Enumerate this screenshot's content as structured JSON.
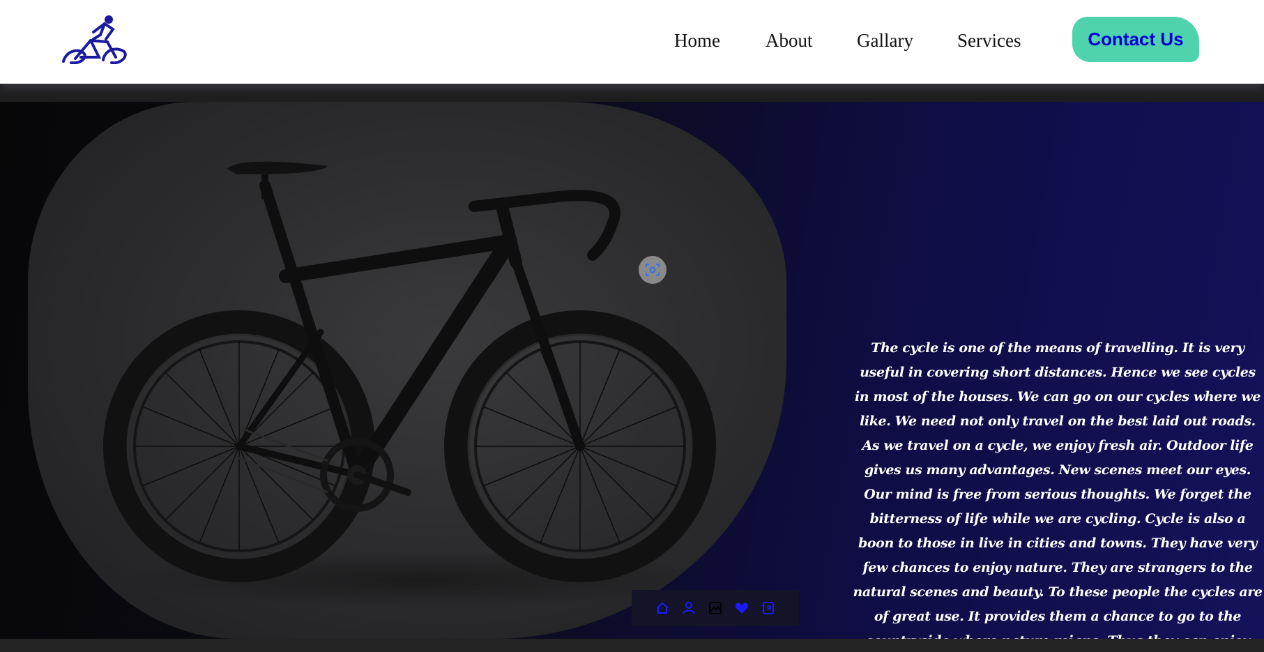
{
  "header": {
    "logo_icon": "cyclist-logo-icon",
    "nav": [
      {
        "label": "Home"
      },
      {
        "label": "About"
      },
      {
        "label": "Gallary"
      },
      {
        "label": "Services"
      }
    ],
    "contact_label": "Contact Us",
    "colors": {
      "contact_bg": "#4fd3ad",
      "contact_text": "#0000d6",
      "logo": "#1a1aa0"
    }
  },
  "hero": {
    "image_icon": "road-bike-image",
    "scan_icon": "scan-icon",
    "paragraph": "The cycle is one of the means of travelling. It is very useful in covering short distances. Hence we see cycles in most of the houses. We can go on our cycles where we like. We need not only travel on the best laid out roads. As we travel on a cycle, we enjoy fresh air. Outdoor life gives us many advantages. New scenes meet our eyes. Our mind is free from serious thoughts. We forget the bitterness of life while we are cycling. Cycle is also a boon to those in live in cities and towns. They have very few chances to enjoy nature. They are strangers to the natural scenes and beauty. To these people the cycles are of great use. It provides them a chance to go to the countryside where nature reigns. Thus they can enjoy the beautiful sight and scenes of nature.",
    "colors": {
      "gradient_start": "#070708",
      "gradient_end": "#14125a"
    }
  },
  "icon_bar": {
    "icons": [
      "home-icon",
      "user-icon",
      "gallery-icon",
      "heart-icon",
      "contact-icon"
    ],
    "color": "#1a1aff"
  }
}
